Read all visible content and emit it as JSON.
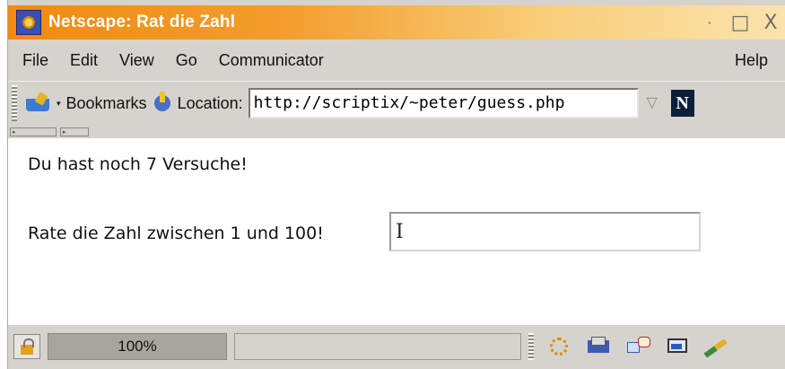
{
  "window": {
    "title": "Netscape: Rat die Zahl"
  },
  "title_controls": {
    "minimize": "·",
    "maximize": "□",
    "close": "X"
  },
  "menu": {
    "items": [
      "File",
      "Edit",
      "View",
      "Go",
      "Communicator"
    ],
    "help": "Help"
  },
  "toolbar": {
    "bookmarks_label": "Bookmarks",
    "location_label": "Location:",
    "url": "http://scriptix/~peter/guess.php",
    "netscape_logo": "N"
  },
  "content": {
    "tries_text": "Du hast noch 7 Versuche!",
    "guess_label": "Rate die Zahl zwischen 1 und 100!",
    "guess_value": ""
  },
  "status": {
    "progress_text": "100%"
  },
  "icons": {
    "app": "netscape-app-icon",
    "bookmarks": "bookmarks-icon",
    "location": "location-icon",
    "security": "lock-icon",
    "components": [
      "navigator-icon",
      "mail-icon",
      "chat-icon",
      "composer-icon",
      "edit-icon"
    ]
  },
  "colors": {
    "title_gradient_start": "#ef8a12",
    "title_gradient_end": "#fbe3ad",
    "chrome": "#d6d3ce"
  }
}
